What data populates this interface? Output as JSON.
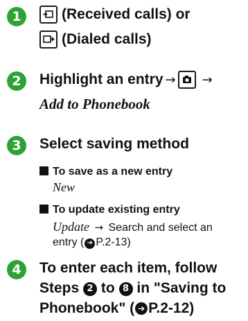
{
  "colors": {
    "step_badge": "#2fa236"
  },
  "step1": {
    "number": "1",
    "received_key_icon": "received-calls-key-icon",
    "received_text": "(Received calls) or",
    "dialed_key_icon": "dialed-calls-key-icon",
    "dialed_text": "(Dialed calls)"
  },
  "step2": {
    "number": "2",
    "text": "Highlight an entry",
    "arrow1": "→",
    "camera_key_icon": "camera-key-icon",
    "arrow2": "→",
    "italic_text": "Add to Phonebook"
  },
  "step3": {
    "number": "3",
    "text": "Select saving method",
    "option1": {
      "heading": "To save as a new entry",
      "value": "New"
    },
    "option2": {
      "heading": "To update existing entry",
      "value": "Update",
      "arrow": "→",
      "line1_rest": "Search and select an",
      "line2_text": "entry (",
      "ref_icon": "arrow-right-circle-icon",
      "ref": "P.2-13",
      "close": ")"
    }
  },
  "step4": {
    "number": "4",
    "line1": "To enter each item, follow",
    "steps_word": "Steps",
    "from_step": "2",
    "to_word": "to",
    "to_step": "8",
    "in_text": "in \"Saving to",
    "line3_text": "Phonebook\" (",
    "ref": "P.2-12",
    "close": ")"
  }
}
